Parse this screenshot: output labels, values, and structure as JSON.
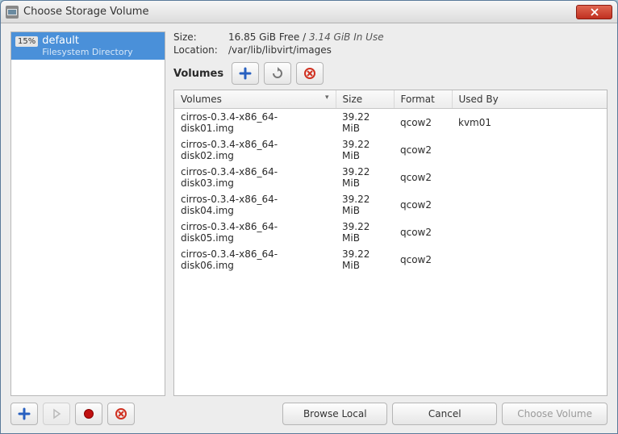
{
  "window": {
    "title": "Choose Storage Volume"
  },
  "sidebar": {
    "pool": {
      "percent": "15%",
      "name": "default",
      "subtitle": "Filesystem Directory"
    }
  },
  "info": {
    "size_label": "Size:",
    "size_free": "16.85 GiB Free",
    "size_sep": " / ",
    "size_inuse": "3.14 GiB In Use",
    "location_label": "Location:",
    "location_value": "/var/lib/libvirt/images"
  },
  "toolbar": {
    "volumes_label": "Volumes",
    "add_icon": "plus-icon",
    "refresh_icon": "refresh-icon",
    "delete_icon": "delete-icon"
  },
  "table": {
    "columns": {
      "volumes": "Volumes",
      "size": "Size",
      "format": "Format",
      "used_by": "Used By"
    },
    "sort_column": "volumes",
    "rows": [
      {
        "name": "cirros-0.3.4-x86_64-disk01.img",
        "size": "39.22 MiB",
        "format": "qcow2",
        "used_by": "kvm01"
      },
      {
        "name": "cirros-0.3.4-x86_64-disk02.img",
        "size": "39.22 MiB",
        "format": "qcow2",
        "used_by": ""
      },
      {
        "name": "cirros-0.3.4-x86_64-disk03.img",
        "size": "39.22 MiB",
        "format": "qcow2",
        "used_by": ""
      },
      {
        "name": "cirros-0.3.4-x86_64-disk04.img",
        "size": "39.22 MiB",
        "format": "qcow2",
        "used_by": ""
      },
      {
        "name": "cirros-0.3.4-x86_64-disk05.img",
        "size": "39.22 MiB",
        "format": "qcow2",
        "used_by": ""
      },
      {
        "name": "cirros-0.3.4-x86_64-disk06.img",
        "size": "39.22 MiB",
        "format": "qcow2",
        "used_by": ""
      }
    ]
  },
  "footer": {
    "add_icon": "plus-icon",
    "play_icon": "play-icon",
    "stop_icon": "stop-icon",
    "delete_icon": "delete-icon",
    "browse_label": "Browse Local",
    "cancel_label": "Cancel",
    "choose_label": "Choose Volume"
  },
  "colors": {
    "selection": "#4a90d9",
    "close_btn": "#c03020",
    "plus": "#2860c0",
    "stop": "#c01010",
    "delete": "#d03020"
  }
}
